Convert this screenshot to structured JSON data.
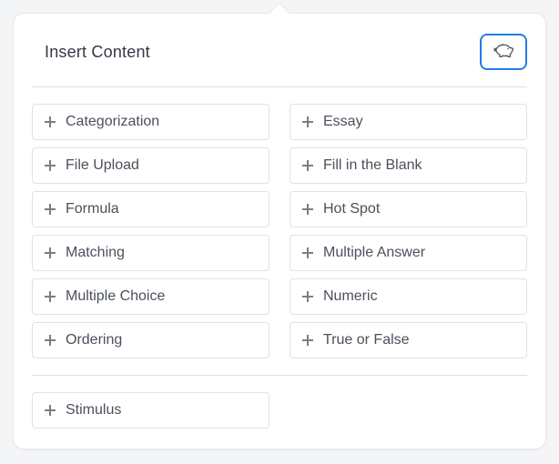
{
  "header": {
    "title": "Insert Content",
    "bank_button_label": "Item Bank"
  },
  "question_types": [
    "Categorization",
    "Essay",
    "File Upload",
    "Fill in the Blank",
    "Formula",
    "Hot Spot",
    "Matching",
    "Multiple Answer",
    "Multiple Choice",
    "Numeric",
    "Ordering",
    "True or False"
  ],
  "extras": [
    "Stimulus"
  ]
}
